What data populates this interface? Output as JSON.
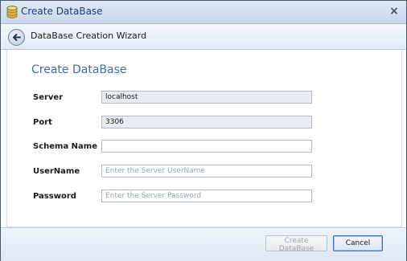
{
  "window": {
    "title": "Create DataBase",
    "close_symbol": "×"
  },
  "wizard": {
    "title": "DataBase Creation Wizard"
  },
  "section": {
    "title": "Create DataBase"
  },
  "form": {
    "server": {
      "label": "Server",
      "value": "localhost",
      "placeholder": ""
    },
    "port": {
      "label": "Port",
      "value": "3306",
      "placeholder": ""
    },
    "schema": {
      "label": "Schema Name",
      "value": "",
      "placeholder": ""
    },
    "username": {
      "label": "UserName",
      "value": "",
      "placeholder": "Enter the Server UserName"
    },
    "password": {
      "label": "Password",
      "value": "",
      "placeholder": "Enter the Server Password"
    }
  },
  "footer": {
    "create_label": "Create DataBase",
    "create_enabled": false,
    "cancel_label": "Cancel"
  },
  "icons": {
    "title": "database-icon",
    "back": "back-arrow-icon",
    "close": "close-icon"
  },
  "colors": {
    "accent": "#3a6ea5",
    "title_text": "#1e3f6e"
  }
}
